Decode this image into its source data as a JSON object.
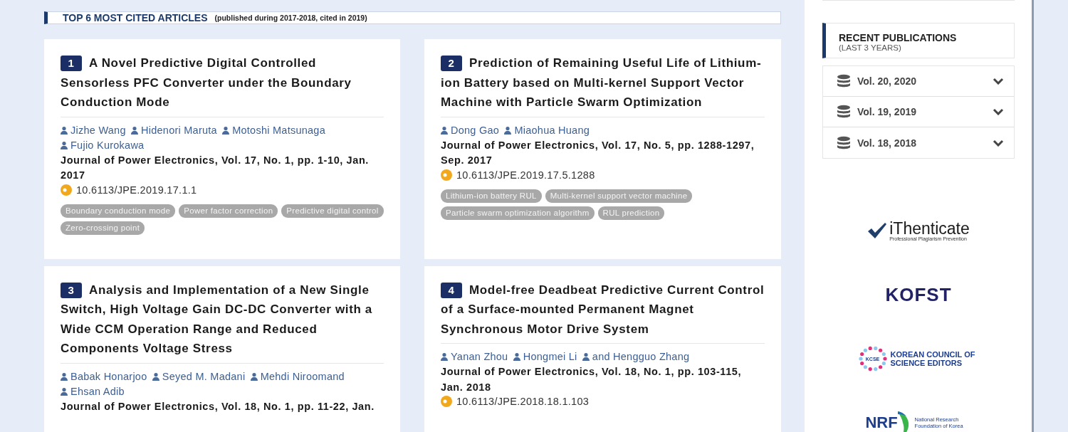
{
  "header": {
    "title": "TOP 6 MOST CITED ARTICLES",
    "subtitle": "(published during 2017-2018, cited in 2019)"
  },
  "articles": [
    {
      "number": "1",
      "title": "A Novel Predictive Digital Controlled Sensorless PFC Converter under the Boundary Conduction Mode",
      "authors": [
        "Jizhe Wang",
        "Hidenori Maruta",
        "Motoshi Matsunaga",
        "Fujio Kurokawa"
      ],
      "journal": "Journal of Power Electronics, Vol. 17, No. 1, pp. 1-10, Jan. 2017",
      "doi": "10.6113/JPE.2019.17.1.1",
      "keywords": [
        "Boundary conduction mode",
        "Power factor correction",
        "Predictive digital control",
        "Zero-crossing point"
      ]
    },
    {
      "number": "2",
      "title": "Prediction of Remaining Useful Life of Lithium-ion Battery based on Multi-kernel Support Vector Machine with Particle Swarm Optimization",
      "authors": [
        "Dong Gao",
        "Miaohua Huang"
      ],
      "journal": "Journal of Power Electronics, Vol. 17, No. 5, pp. 1288-1297, Sep. 2017",
      "doi": "10.6113/JPE.2019.17.5.1288",
      "keywords": [
        "Lithium-ion battery RUL",
        "Multi-kernel support vector machine",
        "Particle swarm optimization algorithm",
        "RUL prediction"
      ]
    },
    {
      "number": "3",
      "title": "Analysis and Implementation of a New Single Switch, High Voltage Gain DC-DC Converter with a Wide CCM Operation Range and Reduced Components Voltage Stress",
      "authors": [
        "Babak Honarjoo",
        "Seyed M. Madani",
        "Mehdi Niroomand",
        "Ehsan Adib"
      ],
      "journal": "Journal of Power Electronics, Vol. 18, No. 1, pp. 11-22, Jan."
    },
    {
      "number": "4",
      "title": "Model-free Deadbeat Predictive Current Control of a Surface-mounted Permanent Magnet Synchronous Motor Drive System",
      "authors": [
        "Yanan Zhou",
        "Hongmei Li",
        "and Hengguo Zhang"
      ],
      "journal": "Journal of Power Electronics, Vol. 18, No. 1, pp. 103-115, Jan. 2018",
      "doi": "10.6113/JPE.2018.18.1.103"
    }
  ],
  "sidebar": {
    "recent": {
      "title": "RECENT PUBLICATIONS",
      "subtitle": "(LAST 3 YEARS)"
    },
    "volumes": [
      {
        "label": "Vol. 20, 2020",
        "expanded": false
      },
      {
        "label": "Vol. 19, 2019",
        "expanded": false
      },
      {
        "label": "Vol. 18, 2018",
        "expanded": false
      }
    ],
    "logos": [
      {
        "kind": "ithenticate",
        "name": "iThenticate",
        "tagline": "Professional Plagiarism Prevention"
      },
      {
        "kind": "kofst",
        "name": "KOFST"
      },
      {
        "kind": "kcse",
        "badge": "KCSE",
        "name": "KOREAN COUNCIL OF SCIENCE EDITORS"
      },
      {
        "kind": "nrf",
        "name": "NRF",
        "tagline": "National Research Foundation of Korea"
      }
    ]
  }
}
